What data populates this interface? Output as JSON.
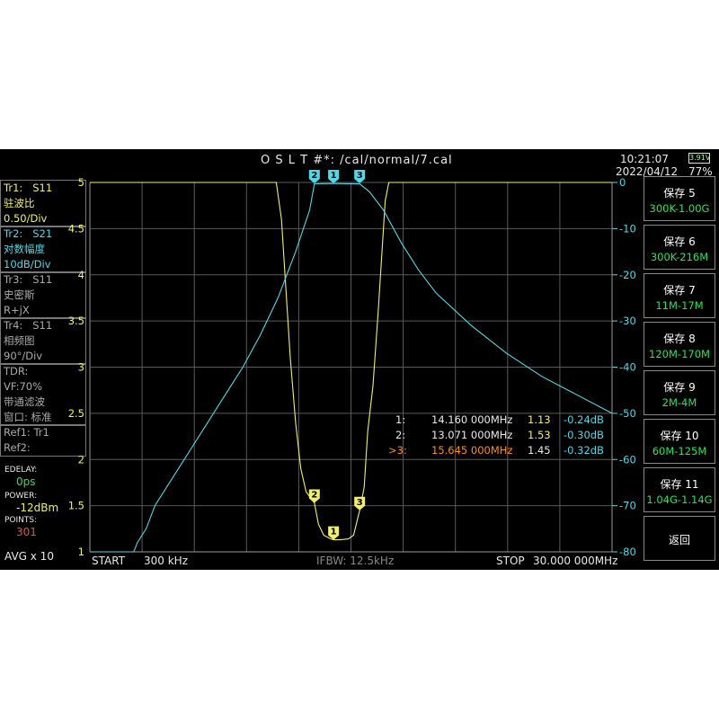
{
  "header": {
    "title": "O S L T #*:   /cal/normal/7.cal",
    "time": "10:21:07",
    "date": "2022/04/12",
    "battery_voltage": "3.91V",
    "battery_percent": "77%"
  },
  "left_panel": {
    "tr1": {
      "name": "Tr1:",
      "param": "S11",
      "format": "驻波比",
      "scale": "0.50/Div"
    },
    "tr2": {
      "name": "Tr2:",
      "param": "S21",
      "format": "对数幅度",
      "scale": "10dB/Div"
    },
    "tr3": {
      "name": "Tr3:",
      "param": "S11",
      "format": "史密斯",
      "scale": "R+jX"
    },
    "tr4": {
      "name": "Tr4:",
      "param": "S11",
      "format": "相频图",
      "scale": "90°/Div"
    },
    "tdr": {
      "title": "TDR:",
      "vf": "VF:70%",
      "filter": "带通滤波",
      "window": "窗口: 标准"
    },
    "ref1": "Ref1:  Tr1",
    "ref2": "Ref2:",
    "edelay_label": "EDELAY:",
    "edelay_value": "0ps",
    "power_label": "POWER:",
    "power_value": "-12dBm",
    "points_label": "POINTS:",
    "points_value": "301",
    "avg": "AVG x 10"
  },
  "right_buttons": [
    {
      "label": "保存 5",
      "sub": "300K-1.00G"
    },
    {
      "label": "保存 6",
      "sub": "300K-216M"
    },
    {
      "label": "保存 7",
      "sub": "11M-17M"
    },
    {
      "label": "保存 8",
      "sub": "120M-170M"
    },
    {
      "label": "保存 9",
      "sub": "2M-4M"
    },
    {
      "label": "保存 10",
      "sub": "60M-125M"
    },
    {
      "label": "保存 11",
      "sub": "1.04G-1.14G"
    },
    {
      "label": "返回",
      "sub": ""
    }
  ],
  "footer": {
    "start_label": "START",
    "start_value": "300 kHz",
    "ifbw": "IFBW: 12.5kHz",
    "stop_label": "STOP",
    "stop_value": "30.000 000MHz"
  },
  "markers_table": [
    {
      "id": "1:",
      "freq": "14.160 000MHz",
      "swr": "1.13",
      "db": "-0.24dB",
      "active": false
    },
    {
      "id": "2:",
      "freq": "13.071 000MHz",
      "swr": "1.53",
      "db": "-0.30dB",
      "active": false
    },
    {
      "id": ">3:",
      "freq": "15.645 000MHz",
      "swr": "1.45",
      "db": "-0.32dB",
      "active": true
    }
  ],
  "colors": {
    "tr1": "#f1ef6c",
    "tr2": "#52d8e6",
    "active_marker": "#ff8c1a",
    "button_sub": "#2fe05a",
    "points": "#ff4545"
  },
  "chart_data": {
    "type": "line",
    "x_start_mhz": 0.3,
    "x_stop_mhz": 30.0,
    "y_left": {
      "label": "SWR",
      "min": 1,
      "max": 5,
      "ticks": [
        "1",
        "1.5",
        "2",
        "2.5",
        "3",
        "3.5",
        "4",
        "4.5",
        "5"
      ]
    },
    "y_right": {
      "label": "dB",
      "min": -80,
      "max": 0,
      "ticks": [
        "0",
        "-10",
        "-20",
        "-30",
        "-40",
        "-50",
        "-60",
        "-70",
        "-80"
      ]
    },
    "grid": true,
    "series": [
      {
        "name": "Tr1: S11",
        "axis": "left",
        "x": [
          0.3,
          10.9,
          11.2,
          11.4,
          11.7,
          12.0,
          12.3,
          12.6,
          13.0,
          13.071,
          13.3,
          13.6,
          14.0,
          14.16,
          14.5,
          15.0,
          15.3,
          15.645,
          15.9,
          16.1,
          16.4,
          16.7,
          16.9,
          17.1,
          17.3,
          17.6,
          30.0
        ],
        "y": [
          5,
          5,
          4.6,
          4.0,
          3.1,
          2.4,
          1.9,
          1.65,
          1.55,
          1.53,
          1.3,
          1.18,
          1.14,
          1.13,
          1.13,
          1.14,
          1.18,
          1.45,
          1.7,
          2.3,
          2.8,
          3.6,
          4.2,
          4.8,
          5,
          5,
          5
        ]
      },
      {
        "name": "Tr2: S21",
        "axis": "right",
        "x": [
          0.3,
          2.0,
          2.8,
          3.0,
          3.5,
          4.0,
          5.0,
          6.0,
          7.0,
          8.0,
          9.0,
          10.0,
          11.0,
          12.0,
          12.8,
          13.071,
          13.5,
          14.16,
          15.0,
          15.645,
          16.2,
          17.0,
          18.0,
          19.0,
          20.0,
          22.0,
          24.0,
          26.0,
          28.0,
          30.0
        ],
        "y": [
          -80,
          -80,
          -80,
          -78,
          -75,
          -70,
          -64,
          -58,
          -52,
          -46,
          -40,
          -33,
          -25,
          -15,
          -6,
          -0.3,
          -0.25,
          -0.24,
          -0.28,
          -0.32,
          -2,
          -6,
          -13,
          -19,
          -24,
          -31,
          -37,
          -42,
          -46,
          -50
        ]
      }
    ],
    "markers": [
      {
        "id": "1",
        "x": 14.16,
        "swr": 1.13,
        "db": -0.24
      },
      {
        "id": "2",
        "x": 13.071,
        "swr": 1.53,
        "db": -0.3
      },
      {
        "id": "3",
        "x": 15.645,
        "swr": 1.45,
        "db": -0.32
      }
    ]
  }
}
